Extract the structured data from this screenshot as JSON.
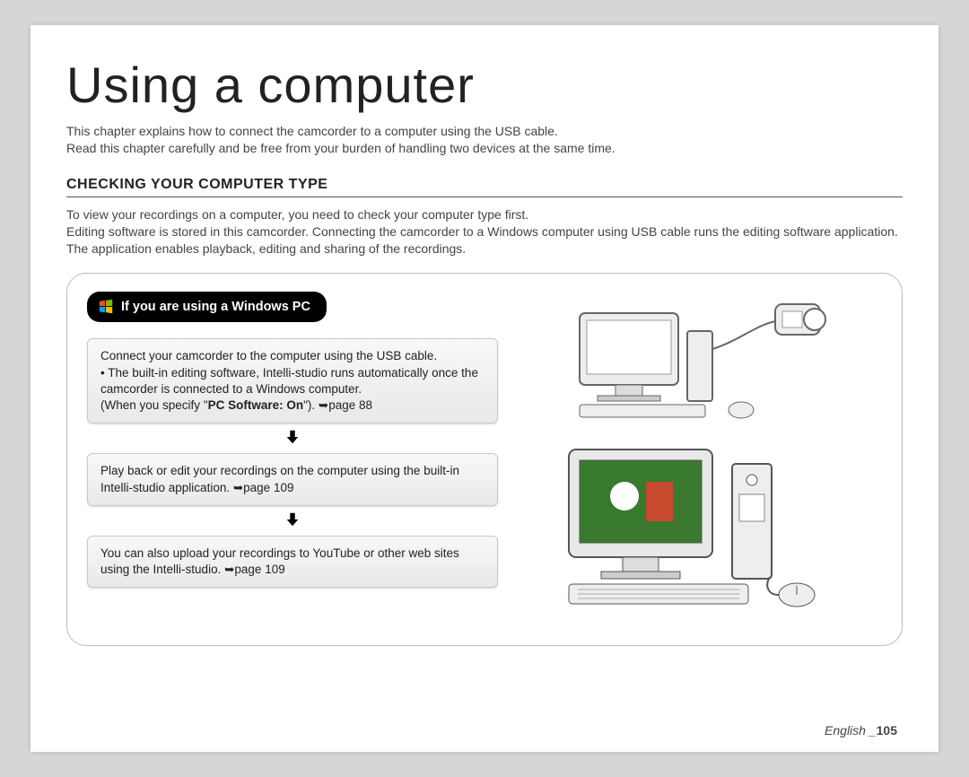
{
  "title": "Using a computer",
  "intro_line1": "This chapter explains how to connect the camcorder to a computer using the USB cable.",
  "intro_line2": "Read this chapter carefully and be free from your burden of handling two devices at the same time.",
  "section": {
    "heading": "CHECKING YOUR COMPUTER TYPE",
    "body_line1": "To view your recordings on a computer, you need to check your computer type first.",
    "body_line2": "Editing software is stored in this camcorder. Connecting the camcorder to a Windows computer using USB cable runs the editing software application. The application enables playback, editing and sharing of the recordings."
  },
  "panel": {
    "pill_label": "If you are using a Windows PC",
    "step1_a": "Connect your camcorder to the computer using the USB cable.",
    "step1_b_prefix": "• The built-in editing software, Intelli-studio runs automatically once the camcorder is connected to a Windows computer.\n(When you specify \"",
    "step1_b_bold": "PC Software: On",
    "step1_b_suffix": "\"). ",
    "step1_pageref": "page 88",
    "step2": "Play back or edit your recordings on the computer using the built-in Intelli-studio application. ",
    "step2_pageref": "page 109",
    "step3": "You can also upload your recordings to YouTube or other web sites using the Intelli-studio. ",
    "step3_pageref": "page 109"
  },
  "footer": {
    "lang": "English ",
    "sep": "_",
    "page": "105"
  },
  "icons": {
    "windows": "windows-logo",
    "arrow_right": "➥"
  }
}
